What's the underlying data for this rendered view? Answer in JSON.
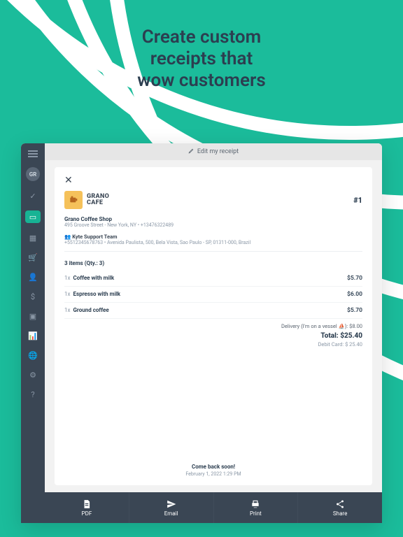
{
  "hero": {
    "line1": "Create custom",
    "line2": "receipts that",
    "line3": "wow customers"
  },
  "sidebar": {
    "avatar_initials": "GR"
  },
  "editbar": {
    "label": "Edit my receipt"
  },
  "receipt": {
    "brand_line1": "GRANO",
    "brand_line2": "CAFE",
    "order_number": "#1",
    "store_name": "Grano Coffee Shop",
    "store_address": "495 Groove Street - New York, NY • +13476322489",
    "customer_name": "Kyte Support Team",
    "customer_line2": "+5512345678763 • Avenida Paulista, 500, Bela Vista, Sao Paulo - SP, 01311-000, Brazil",
    "items_summary": "3 items (Qty.: 3)",
    "items": [
      {
        "qty": "1x",
        "name": "Coffee with milk",
        "price": "$5.70"
      },
      {
        "qty": "1x",
        "name": "Espresso with milk",
        "price": "$6.00"
      },
      {
        "qty": "1x",
        "name": "Ground coffee",
        "price": "$5.70"
      }
    ],
    "delivery_label": "Delivery (I'm on a vessel ⛵): $8.00",
    "total_label": "Total: $25.40",
    "payment_label": "Debit Card: $ 25.40",
    "footer_msg": "Come back soon!",
    "timestamp": "February 1, 2022 1:29 PM"
  },
  "actions": {
    "pdf": "PDF",
    "email": "Email",
    "print": "Print",
    "share": "Share"
  }
}
